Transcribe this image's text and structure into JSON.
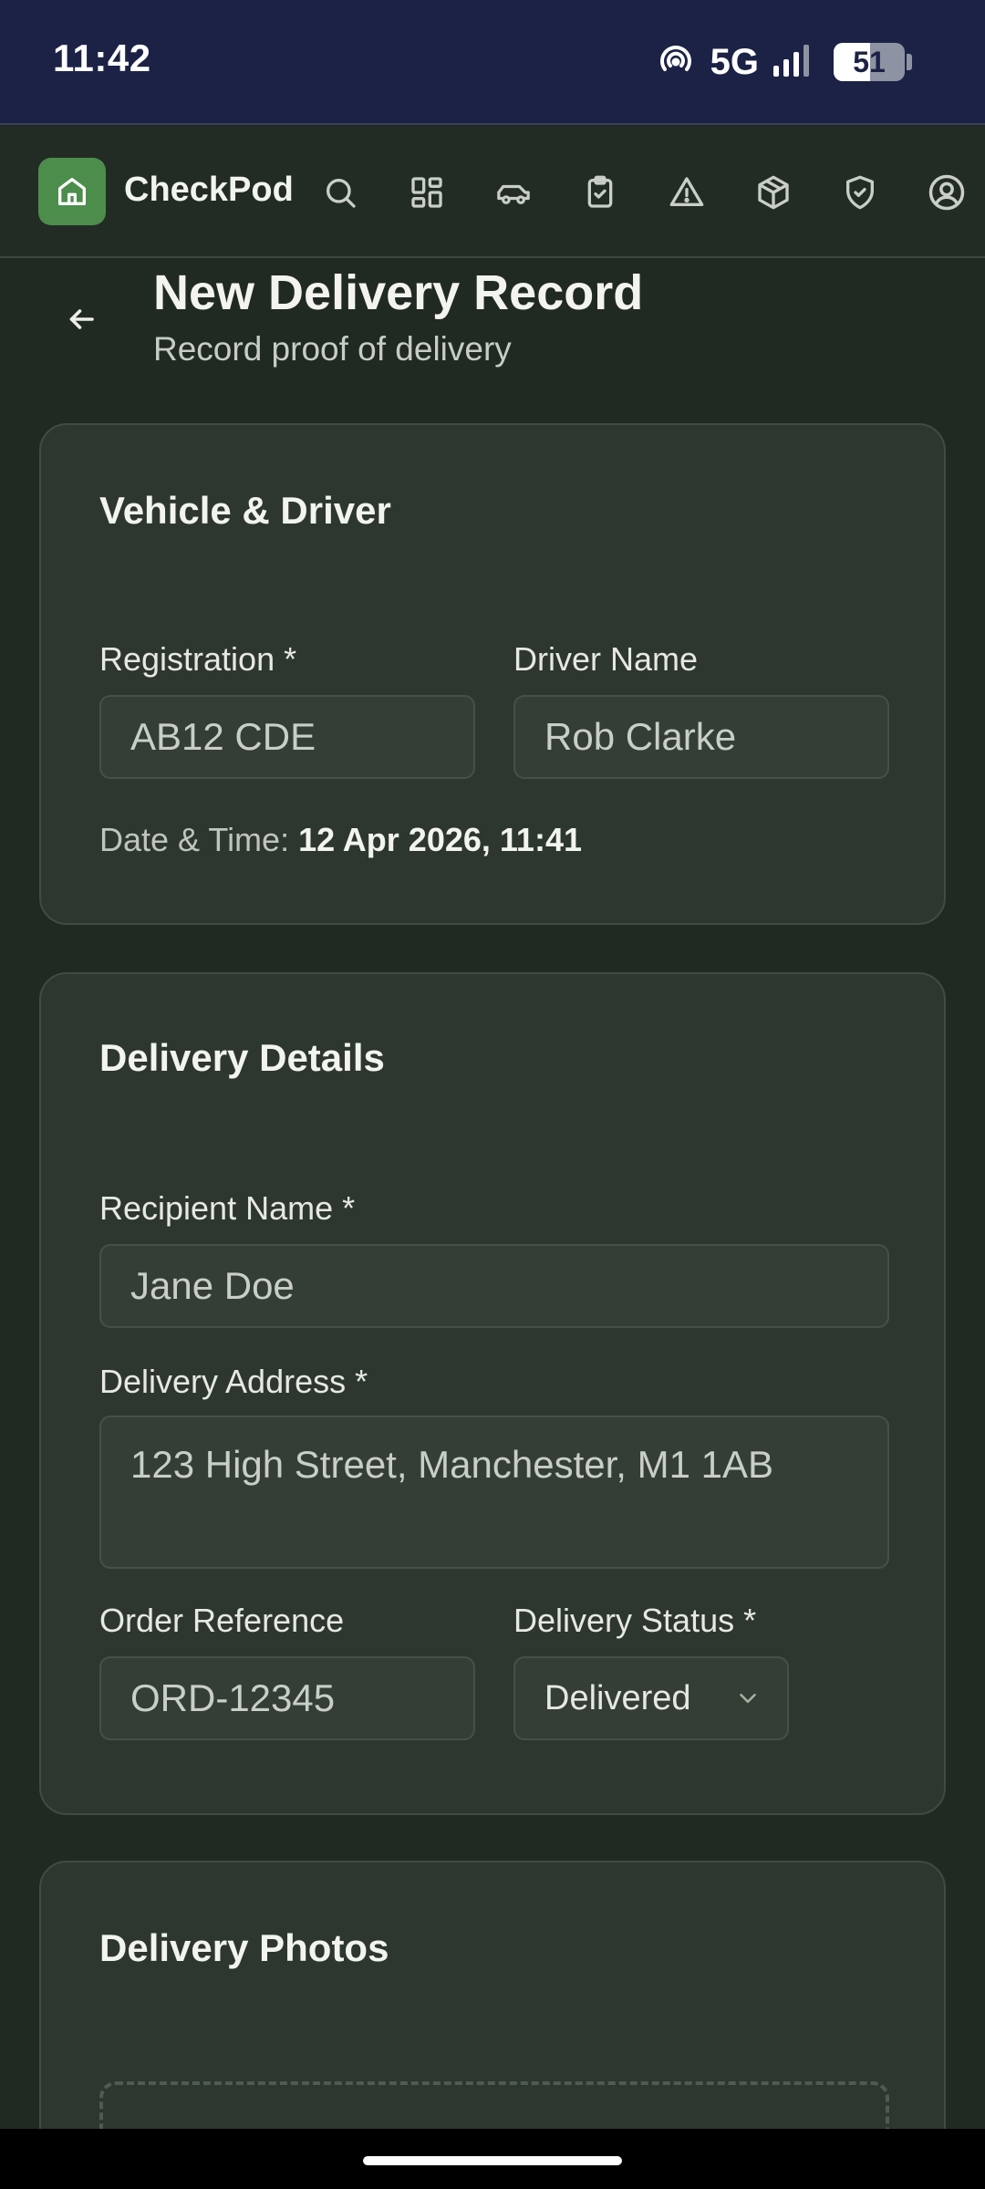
{
  "status_bar": {
    "time": "11:42",
    "network": "5G",
    "battery": "51",
    "battery_level": 0.51
  },
  "app": {
    "brand": "CheckPod",
    "nav_icons": [
      "search-icon",
      "dashboard-icon",
      "vehicle-icon",
      "checklist-icon",
      "warning-icon",
      "package-icon",
      "shield-icon",
      "account-icon"
    ]
  },
  "header": {
    "title": "New Delivery Record",
    "subtitle": "Record proof of delivery"
  },
  "vehicle_card": {
    "title": "Vehicle & Driver",
    "registration_label": "Registration *",
    "registration_value": "AB12 CDE",
    "driver_label": "Driver Name",
    "driver_value": "Rob Clarke",
    "datetime_label": "Date & Time:",
    "datetime_value": "12 Apr 2026, 11:41"
  },
  "delivery_card": {
    "title": "Delivery Details",
    "recipient_label": "Recipient Name *",
    "recipient_value": "Jane Doe",
    "address_label": "Delivery Address *",
    "address_value": "123 High Street, Manchester, M1 1AB",
    "order_label": "Order Reference",
    "order_value": "ORD-12345",
    "status_label": "Delivery Status *",
    "status_value": "Delivered"
  },
  "photos_card": {
    "title": "Delivery Photos"
  }
}
